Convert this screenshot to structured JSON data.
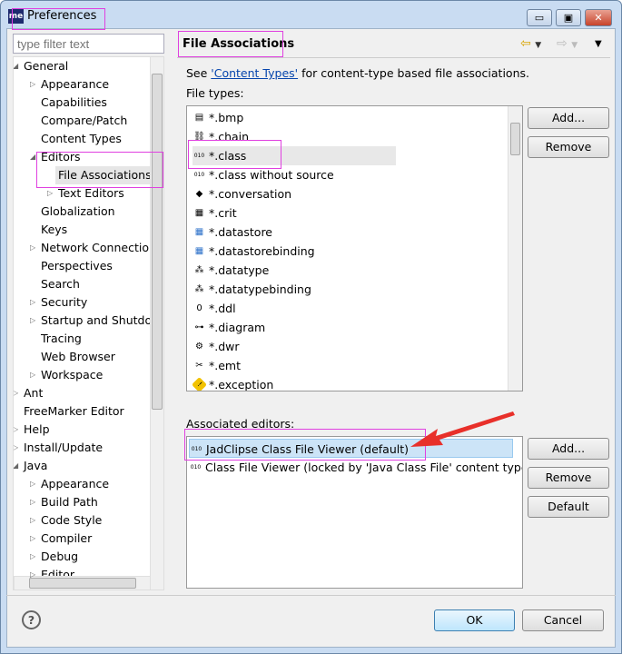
{
  "window": {
    "title": "Preferences",
    "logo": "me"
  },
  "filter": {
    "placeholder": "type filter text"
  },
  "tree": [
    {
      "label": "General",
      "level": 0,
      "arrow": "open"
    },
    {
      "label": "Appearance",
      "level": 1,
      "arrow": "closed"
    },
    {
      "label": "Capabilities",
      "level": 1,
      "arrow": ""
    },
    {
      "label": "Compare/Patch",
      "level": 1,
      "arrow": ""
    },
    {
      "label": "Content Types",
      "level": 1,
      "arrow": ""
    },
    {
      "label": "Editors",
      "level": 1,
      "arrow": "open"
    },
    {
      "label": "File Associations",
      "level": 2,
      "arrow": "",
      "selected": true
    },
    {
      "label": "Text Editors",
      "level": 2,
      "arrow": "closed"
    },
    {
      "label": "Globalization",
      "level": 1,
      "arrow": ""
    },
    {
      "label": "Keys",
      "level": 1,
      "arrow": ""
    },
    {
      "label": "Network Connections",
      "level": 1,
      "arrow": "closed"
    },
    {
      "label": "Perspectives",
      "level": 1,
      "arrow": ""
    },
    {
      "label": "Search",
      "level": 1,
      "arrow": ""
    },
    {
      "label": "Security",
      "level": 1,
      "arrow": "closed"
    },
    {
      "label": "Startup and Shutdown",
      "level": 1,
      "arrow": "closed"
    },
    {
      "label": "Tracing",
      "level": 1,
      "arrow": ""
    },
    {
      "label": "Web Browser",
      "level": 1,
      "arrow": ""
    },
    {
      "label": "Workspace",
      "level": 1,
      "arrow": "closed"
    },
    {
      "label": "Ant",
      "level": 0,
      "arrow": "closed"
    },
    {
      "label": "FreeMarker Editor",
      "level": 0,
      "arrow": ""
    },
    {
      "label": "Help",
      "level": 0,
      "arrow": "closed"
    },
    {
      "label": "Install/Update",
      "level": 0,
      "arrow": "closed"
    },
    {
      "label": "Java",
      "level": 0,
      "arrow": "open"
    },
    {
      "label": "Appearance",
      "level": 1,
      "arrow": "closed"
    },
    {
      "label": "Build Path",
      "level": 1,
      "arrow": "closed"
    },
    {
      "label": "Code Style",
      "level": 1,
      "arrow": "closed"
    },
    {
      "label": "Compiler",
      "level": 1,
      "arrow": "closed"
    },
    {
      "label": "Debug",
      "level": 1,
      "arrow": "closed"
    },
    {
      "label": "Editor",
      "level": 1,
      "arrow": "closed"
    }
  ],
  "page": {
    "title": "File Associations",
    "desc_pre": "See ",
    "desc_link": "'Content Types'",
    "desc_post": " for content-type based file associations.",
    "file_types_label": "File types:",
    "file_types": [
      {
        "name": "*.bmp",
        "icon": "file-icon",
        "glyph": "▤"
      },
      {
        "name": "*.chain",
        "icon": "chain-icon",
        "glyph": "⛓"
      },
      {
        "name": "*.class",
        "icon": "class-file-icon",
        "glyph": "010",
        "selected": true
      },
      {
        "name": "*.class without source",
        "icon": "class-file-icon",
        "glyph": "010"
      },
      {
        "name": "*.conversation",
        "icon": "conversation-icon",
        "glyph": "◆"
      },
      {
        "name": "*.crit",
        "icon": "crit-icon",
        "glyph": "▦"
      },
      {
        "name": "*.datastore",
        "icon": "table-icon",
        "glyph": "▦"
      },
      {
        "name": "*.datastorebinding",
        "icon": "table-icon",
        "glyph": "▦"
      },
      {
        "name": "*.datatype",
        "icon": "datatype-icon",
        "glyph": "⁂"
      },
      {
        "name": "*.datatypebinding",
        "icon": "datatype-icon",
        "glyph": "⁂"
      },
      {
        "name": "*.ddl",
        "icon": "ddl-icon",
        "glyph": "0"
      },
      {
        "name": "*.diagram",
        "icon": "diagram-icon",
        "glyph": "⊶"
      },
      {
        "name": "*.dwr",
        "icon": "gear-icon",
        "glyph": "⚙"
      },
      {
        "name": "*.emt",
        "icon": "emt-icon",
        "glyph": "✂"
      },
      {
        "name": "*.exception",
        "icon": "warning-icon",
        "glyph": "!"
      }
    ],
    "add": "Add...",
    "remove": "Remove",
    "editors_label": "Associated editors:",
    "editors": [
      {
        "name": "JadClipse Class File Viewer (default)",
        "selected": true
      },
      {
        "name": "Class File Viewer (locked by 'Java Class File' content type)"
      }
    ],
    "default": "Default"
  },
  "footer": {
    "ok": "OK",
    "cancel": "Cancel",
    "help": "?"
  },
  "colors": {
    "annotation": "#e040e0",
    "arrow": "#e8302a",
    "selection": "#cce4f7"
  }
}
